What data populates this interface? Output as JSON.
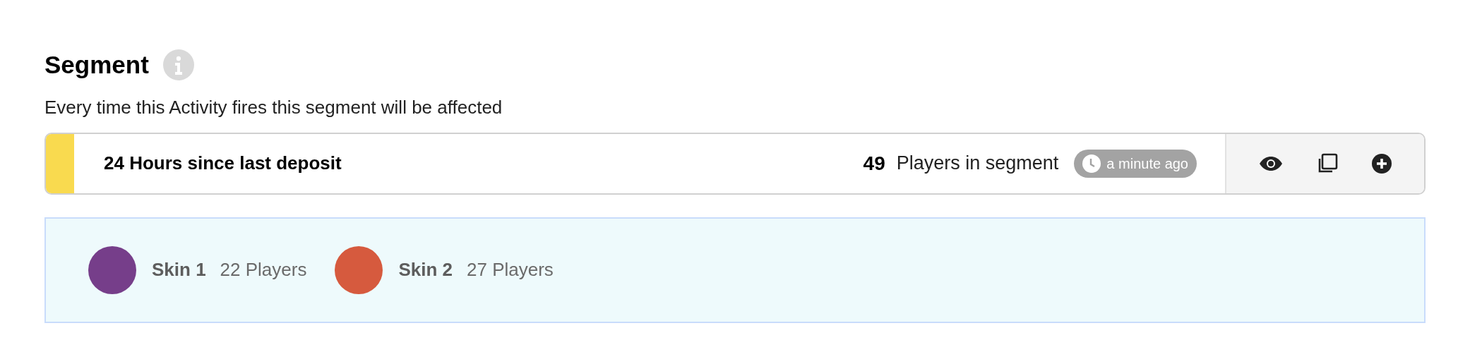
{
  "section": {
    "title": "Segment",
    "description": "Every time this Activity fires this segment will be affected"
  },
  "segment": {
    "name": "24 Hours since last deposit",
    "count": "49",
    "count_label": "Players in segment",
    "updated": "a minute ago"
  },
  "skins": [
    {
      "name": "Skin 1",
      "players": "22 Players",
      "color": "#763e8a"
    },
    {
      "name": "Skin 2",
      "players": "27 Players",
      "color": "#d65a3e"
    }
  ]
}
